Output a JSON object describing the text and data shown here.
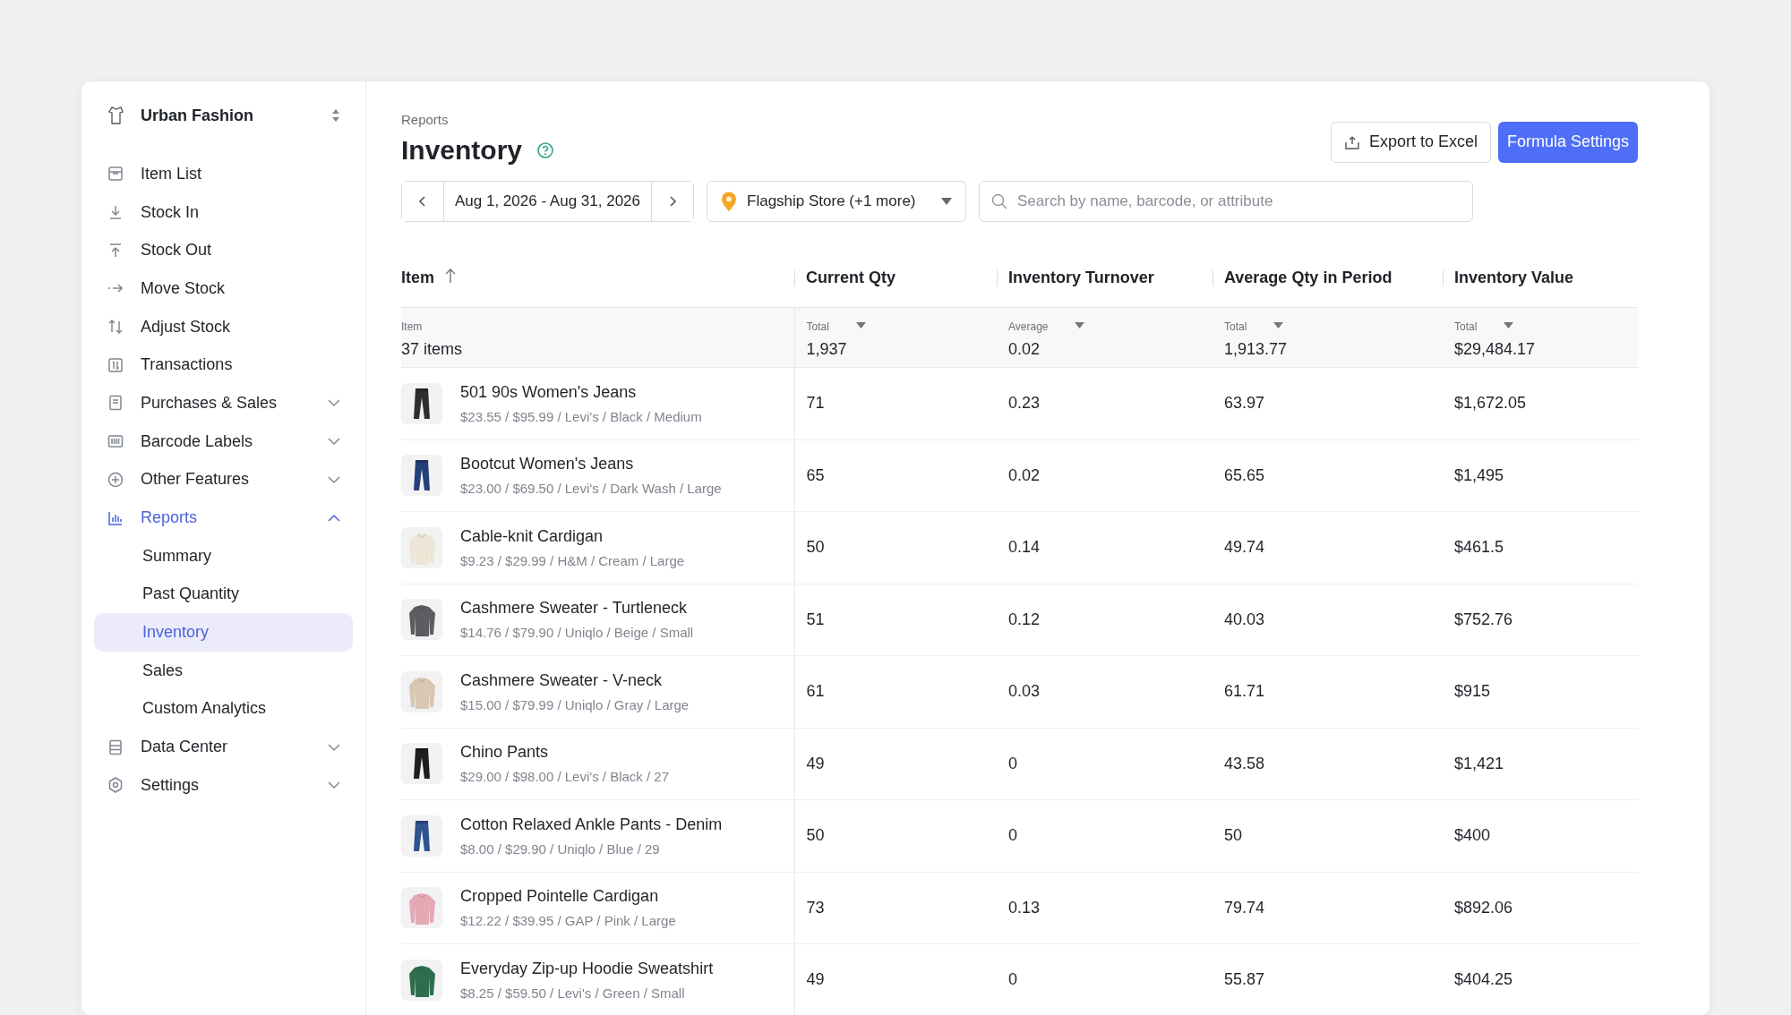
{
  "brand": {
    "name": "Urban Fashion"
  },
  "sidebar": {
    "items": [
      {
        "label": "Item List",
        "selected": false
      },
      {
        "label": "Stock In",
        "selected": false
      },
      {
        "label": "Stock Out",
        "selected": false
      },
      {
        "label": "Move Stock",
        "selected": false
      },
      {
        "label": "Adjust Stock",
        "selected": false
      },
      {
        "label": "Transactions",
        "selected": false
      },
      {
        "label": "Purchases & Sales",
        "selected": false,
        "expanded": false
      },
      {
        "label": "Barcode Labels",
        "selected": false,
        "expanded": false
      },
      {
        "label": "Other Features",
        "selected": false,
        "expanded": false
      },
      {
        "label": "Reports",
        "selected": true,
        "expanded": true,
        "children": [
          {
            "label": "Summary",
            "selected": false
          },
          {
            "label": "Past Quantity",
            "selected": false
          },
          {
            "label": "Inventory",
            "selected": true
          },
          {
            "label": "Sales",
            "selected": false
          },
          {
            "label": "Custom Analytics",
            "selected": false
          }
        ]
      },
      {
        "label": "Data Center",
        "selected": false,
        "expanded": false
      },
      {
        "label": "Settings",
        "selected": false,
        "expanded": false
      }
    ]
  },
  "breadcrumb": "Reports",
  "title": "Inventory",
  "buttons": {
    "export": "Export to Excel",
    "formula": "Formula Settings"
  },
  "date_range": "Aug 1, 2026 - Aug 31, 2026",
  "store_filter": "Flagship Store (+1 more)",
  "search": {
    "placeholder": "Search by name, barcode, or attribute"
  },
  "table": {
    "columns": [
      {
        "label": "Item",
        "sorted": true
      },
      {
        "label": "Current Qty"
      },
      {
        "label": "Inventory Turnover"
      },
      {
        "label": "Average Qty in Period"
      },
      {
        "label": "Inventory Value"
      }
    ],
    "summary": [
      {
        "label": "Item",
        "value": "37 items"
      },
      {
        "label": "Total",
        "value": "1,937"
      },
      {
        "label": "Average",
        "value": "0.02"
      },
      {
        "label": "Total",
        "value": "1,913.77"
      },
      {
        "label": "Total",
        "value": "$29,484.17"
      }
    ],
    "rows": [
      {
        "name": "501 90s Women's Jeans",
        "details": "$23.55 / $95.99 / Levi's / Black / Medium",
        "qty": "71",
        "turnover": "0.23",
        "avg": "63.97",
        "value": "$1,672.05"
      },
      {
        "name": "Bootcut Women's Jeans",
        "details": "$23.00 / $69.50 / Levi's / Dark Wash / Large",
        "qty": "65",
        "turnover": "0.02",
        "avg": "65.65",
        "value": "$1,495"
      },
      {
        "name": "Cable-knit Cardigan",
        "details": "$9.23 / $29.99 / H&M / Cream / Large",
        "qty": "50",
        "turnover": "0.14",
        "avg": "49.74",
        "value": "$461.5"
      },
      {
        "name": "Cashmere Sweater - Turtleneck",
        "details": "$14.76 / $79.90 / Uniqlo / Beige / Small",
        "qty": "51",
        "turnover": "0.12",
        "avg": "40.03",
        "value": "$752.76"
      },
      {
        "name": "Cashmere Sweater - V-neck",
        "details": "$15.00 / $79.99 / Uniqlo / Gray / Large",
        "qty": "61",
        "turnover": "0.03",
        "avg": "61.71",
        "value": "$915"
      },
      {
        "name": "Chino Pants",
        "details": "$29.00 / $98.00 / Levi's / Black / 27",
        "qty": "49",
        "turnover": "0",
        "avg": "43.58",
        "value": "$1,421"
      },
      {
        "name": "Cotton Relaxed Ankle Pants - Denim",
        "details": "$8.00 / $29.90 / Uniqlo / Blue / 29",
        "qty": "50",
        "turnover": "0",
        "avg": "50",
        "value": "$400"
      },
      {
        "name": "Cropped Pointelle Cardigan",
        "details": "$12.22 / $39.95 / GAP / Pink / Large",
        "qty": "73",
        "turnover": "0.13",
        "avg": "79.74",
        "value": "$892.06"
      },
      {
        "name": "Everyday Zip-up Hoodie Sweatshirt",
        "details": "$8.25 / $59.50 / Levi's / Green / Small",
        "qty": "49",
        "turnover": "0",
        "avg": "55.87",
        "value": "$404.25"
      }
    ]
  }
}
